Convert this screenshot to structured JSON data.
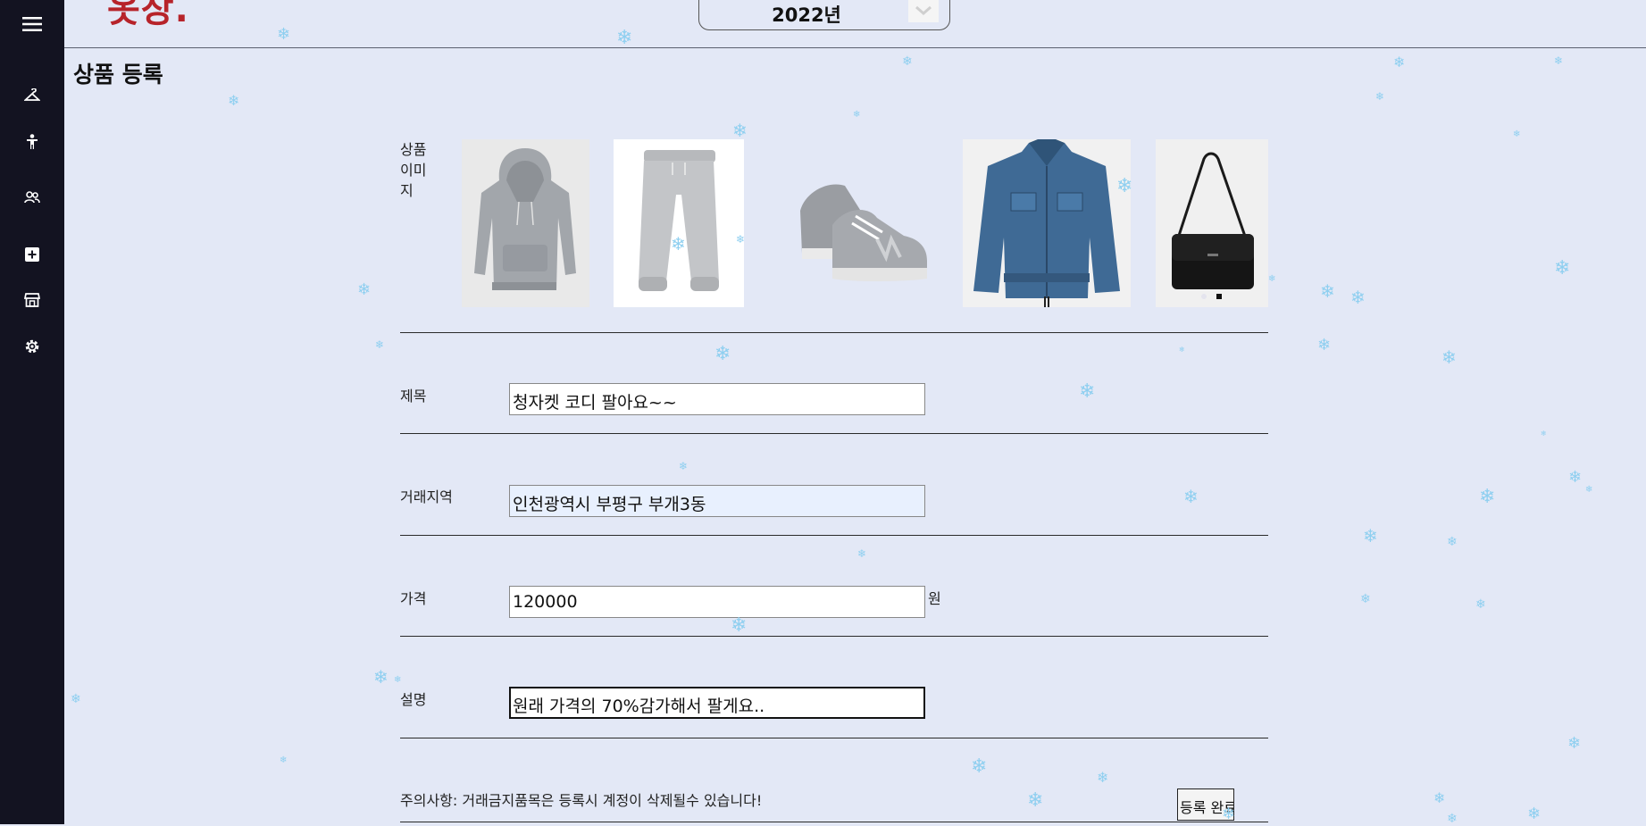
{
  "app": {
    "logo_text": "옷장.",
    "year": "2022년"
  },
  "sidebar": {
    "items": [
      {
        "icon": "menu-icon"
      },
      {
        "icon": "hanger-icon"
      },
      {
        "icon": "person-icon"
      },
      {
        "icon": "users-icon"
      },
      {
        "icon": "add-icon"
      },
      {
        "icon": "store-icon"
      },
      {
        "icon": "gear-icon"
      }
    ]
  },
  "page": {
    "title": "상품 등록"
  },
  "form": {
    "image_label": "상품\n이미\n지",
    "images": [
      {
        "name": "gray-hoodie"
      },
      {
        "name": "gray-sweatpants"
      },
      {
        "name": "gray-sneakers"
      },
      {
        "name": "denim-jacket"
      },
      {
        "name": "black-messenger-bag"
      }
    ],
    "title_label": "제목",
    "title_value": "청자켓 코디 팔아요~~",
    "region_label": "거래지역",
    "region_value": "인천광역시 부평구 부개3동",
    "price_label": "가격",
    "price_value": "120000",
    "price_unit": "원",
    "desc_label": "설명",
    "desc_value": "원래 가격의 70%감가해서 팔게요..",
    "notice": "주의사항: 거래금지품목은 등록시 계정이 삭제될수 있습니다!",
    "submit_label": "등록 완료"
  },
  "colors": {
    "sidebar": "#131321",
    "background": "#e3e8f6",
    "logo": "#b7232a",
    "snow": "#8ecff0"
  }
}
